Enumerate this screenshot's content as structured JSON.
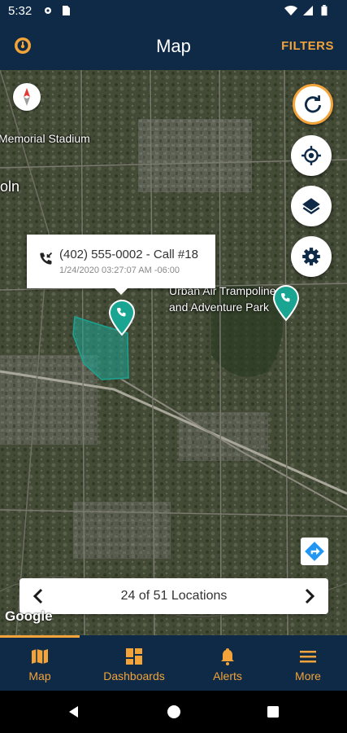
{
  "status_bar": {
    "time": "5:32"
  },
  "app_bar": {
    "title": "Map",
    "filters_label": "FILTERS"
  },
  "map": {
    "labels": {
      "memorial_stadium": "Memorial Stadium",
      "lincoln_partial": "oln",
      "urban_air_line1": "Urban Air Trampoline",
      "urban_air_line2": "and Adventure Park"
    },
    "callout": {
      "title": "(402) 555-0002 - Call #18",
      "subtitle": "1/24/2020 03:27:07 AM -06:00"
    },
    "locations_bar": {
      "text": "24 of 51 Locations"
    },
    "attribution": "Google"
  },
  "tabs": [
    {
      "label": "Map",
      "icon": "map-icon"
    },
    {
      "label": "Dashboards",
      "icon": "dashboard-icon"
    },
    {
      "label": "Alerts",
      "icon": "bell-icon"
    },
    {
      "label": "More",
      "icon": "menu-icon"
    }
  ],
  "colors": {
    "primary": "#0e2a47",
    "accent": "#f2a33a",
    "marker": "#1aa593"
  }
}
